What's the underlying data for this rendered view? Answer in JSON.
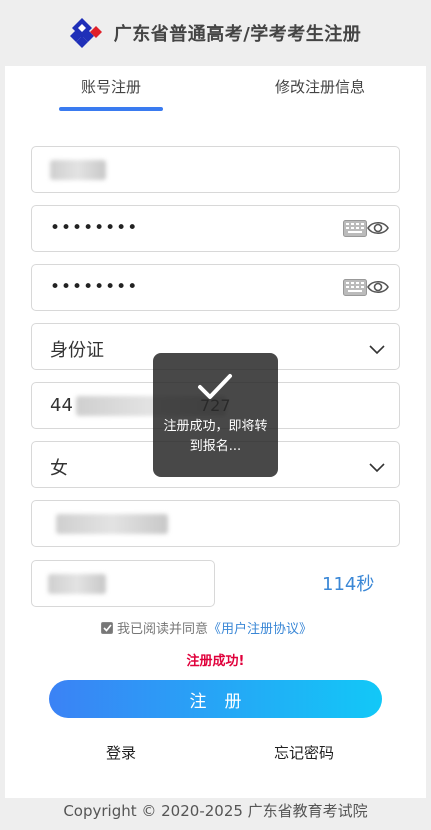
{
  "header": {
    "title": "广东省普通高考/学考考生注册"
  },
  "tabs": [
    {
      "label": "账号注册",
      "active": true
    },
    {
      "label": "修改注册信息",
      "active": false
    }
  ],
  "form": {
    "password_mask": "••••••••",
    "confirm_mask": "••••••••",
    "id_type": "身份证",
    "id_number_prefix": "44",
    "id_number_suffix": "727",
    "gender": "女",
    "countdown": "114秒"
  },
  "agreement": {
    "text": "我已阅读并同意",
    "link": "《用户注册协议》",
    "checked": true
  },
  "status_message": "注册成功!",
  "submit_label": "注册",
  "links": {
    "login": "登录",
    "forgot": "忘记密码"
  },
  "footer": "Copyright © 2020-2025 广东省教育考试院",
  "toast": {
    "text": "注册成功，即将转到报名..."
  },
  "colors": {
    "accent": "#3a7bf0",
    "success_red": "#e0003b",
    "link_blue": "#3a87d6"
  }
}
